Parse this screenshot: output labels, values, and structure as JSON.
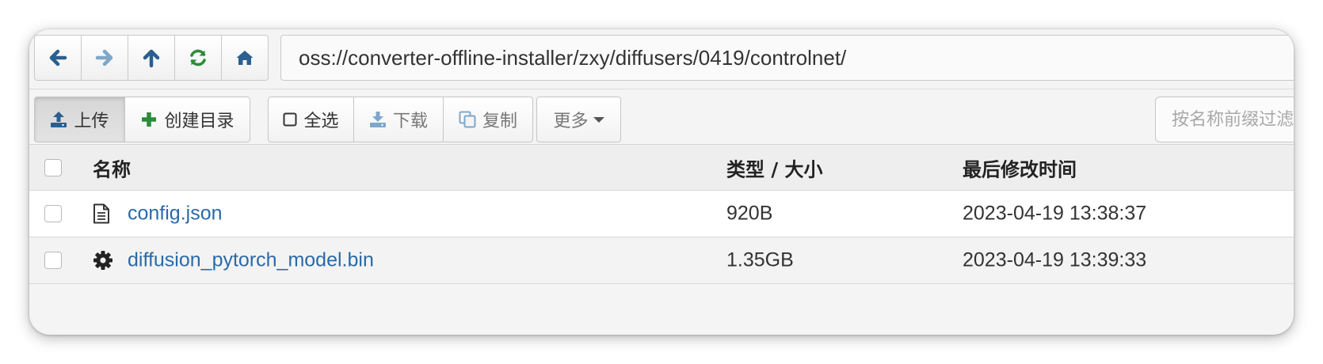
{
  "nav": {
    "buttons": [
      {
        "name": "back",
        "icon": "arrow-left-icon",
        "color": "#2a5f8f"
      },
      {
        "name": "forward",
        "icon": "arrow-right-icon",
        "color": "#7ea7c8"
      },
      {
        "name": "up",
        "icon": "arrow-up-icon",
        "color": "#2a5f8f"
      },
      {
        "name": "refresh",
        "icon": "refresh-icon",
        "color": "#2e8b3a"
      },
      {
        "name": "home",
        "icon": "home-icon",
        "color": "#2a5f8f"
      }
    ],
    "address": "oss://converter-offline-installer/zxy/diffusers/0419/controlnet/"
  },
  "toolbar": {
    "upload_label": "上传",
    "mkdir_label": "创建目录",
    "select_all_label": "全选",
    "download_label": "下载",
    "copy_label": "复制",
    "more_label": "更多",
    "filter_placeholder": "按名称前缀过滤"
  },
  "table": {
    "headers": {
      "name": "名称",
      "type_size": "类型 / 大小",
      "modified": "最后修改时间"
    },
    "rows": [
      {
        "icon": "file-text-icon",
        "name": "config.json",
        "size": "920B",
        "modified": "2023-04-19 13:38:37"
      },
      {
        "icon": "gear-icon",
        "name": "diffusion_pytorch_model.bin",
        "size": "1.35GB",
        "modified": "2023-04-19 13:39:33"
      }
    ]
  },
  "colors": {
    "link": "#2a6aa8",
    "add_icon": "#2e8b3a",
    "nav_primary": "#2a5f8f"
  }
}
